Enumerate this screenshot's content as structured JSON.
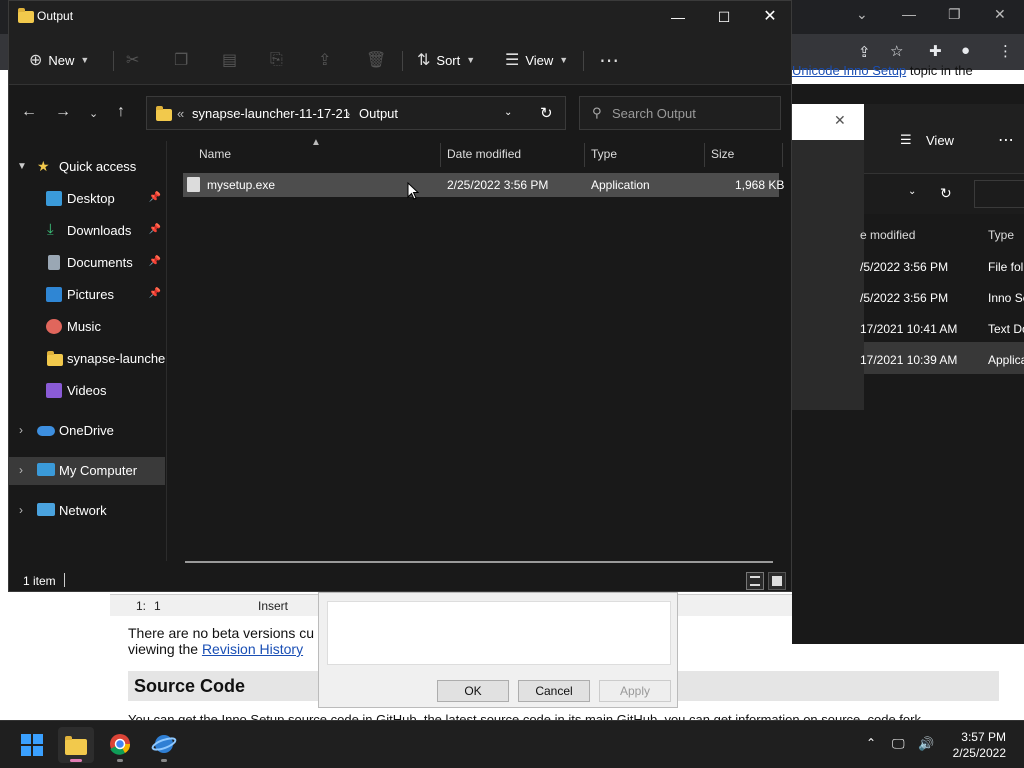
{
  "browser": {
    "toolbar_link": "Unicode Inno Setup",
    "toolbar_text": "topic in the"
  },
  "web": {
    "beta_text": "There are no beta versions cu",
    "viewing_text": "viewing the",
    "revision_link": "Revision History",
    "source_code_heading": "Source Code",
    "bottom_text": "You can get the Inno Setup source code in GitHub, the latest source code in its main GitHub, you can get information on source, code fork"
  },
  "inno_editor": {
    "line": "1:",
    "col": "1",
    "mode": "Insert"
  },
  "inno_dialog": {
    "ok_label": "OK",
    "cancel_label": "Cancel",
    "apply_label": "Apply"
  },
  "explorer2": {
    "view_label": "View",
    "col_date": "e modified",
    "col_type": "Type",
    "rows": [
      {
        "date": "/5/2022 3:56 PM",
        "type": "File fol"
      },
      {
        "date": "/5/2022 3:56 PM",
        "type": "Inno Se"
      },
      {
        "date": "17/2021 10:41 AM",
        "type": "Text Do"
      },
      {
        "date": "17/2021 10:39 AM",
        "type": "Applica"
      }
    ]
  },
  "explorer": {
    "title": "Output",
    "toolbar": {
      "new_label": "New",
      "sort_label": "Sort",
      "view_label": "View"
    },
    "address": {
      "overflow": "«",
      "crumb1": "synapse-launcher-11-17-21",
      "crumb2": "Output"
    },
    "search_placeholder": "Search Output",
    "nav": {
      "quick_access": "Quick access",
      "items": [
        {
          "label": "Desktop",
          "pinned": true
        },
        {
          "label": "Downloads",
          "pinned": true
        },
        {
          "label": "Documents",
          "pinned": true
        },
        {
          "label": "Pictures",
          "pinned": true
        },
        {
          "label": "Music",
          "pinned": false
        },
        {
          "label": "synapse-launcher-",
          "pinned": false
        },
        {
          "label": "Videos",
          "pinned": false
        }
      ],
      "onedrive": "OneDrive",
      "my_computer": "My Computer",
      "network": "Network"
    },
    "columns": {
      "name": "Name",
      "date": "Date modified",
      "type": "Type",
      "size": "Size"
    },
    "files": [
      {
        "name": "mysetup.exe",
        "date": "2/25/2022 3:56 PM",
        "type": "Application",
        "size": "1,968 KB"
      }
    ],
    "status": "1 item"
  },
  "taskbar": {
    "time": "3:57 PM",
    "date": "2/25/2022"
  },
  "colors": {
    "accent": "#0078d4",
    "folder": "#f2c94c",
    "selected_row": "#4d4d4d",
    "window_bg": "#191919"
  }
}
